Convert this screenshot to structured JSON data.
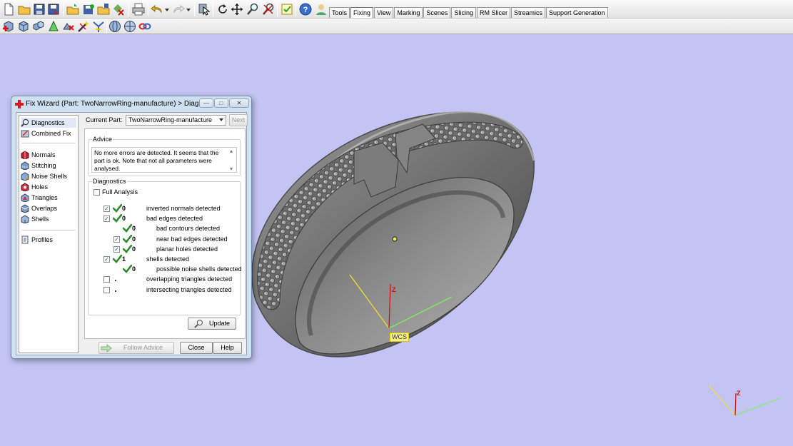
{
  "tabs": [
    {
      "label": "Tools",
      "active": false
    },
    {
      "label": "Fixing",
      "active": true
    },
    {
      "label": "View",
      "active": false
    },
    {
      "label": "Marking",
      "active": false
    },
    {
      "label": "Scenes",
      "active": false
    },
    {
      "label": "Slicing",
      "active": false
    },
    {
      "label": "RM Slicer",
      "active": false
    },
    {
      "label": "Streamics",
      "active": false
    },
    {
      "label": "Support Generation",
      "active": false
    }
  ],
  "toolbar_icons": [
    "new-file-icon",
    "open-folder-icon",
    "save-icon",
    "save-as-icon",
    "import-icon",
    "save-project-icon",
    "load-icon",
    "export-icon",
    "print-icon",
    "undo-icon",
    "redo-icon",
    "select-part-icon",
    "rotate-icon",
    "pan-icon",
    "zoom-icon",
    "zoom-fit-icon",
    "checklist-icon",
    "help-icon",
    "about-icon"
  ],
  "fix_toolbar_icons": [
    "add-part-icon",
    "box-icon",
    "cubes-icon",
    "triangle-icon",
    "delete-triangles-icon",
    "wand-icon",
    "sew-icon",
    "sphere-icon",
    "sphere-grid-icon",
    "link-icon"
  ],
  "wizard": {
    "title": "Fix Wizard (Part: TwoNarrowRing-manufacture) > Diagnostics",
    "nav": [
      {
        "label": "Diagnostics",
        "icon": "magnifier-icon",
        "selected": true
      },
      {
        "label": "Combined Fix",
        "icon": "combined-fix-icon",
        "selected": false
      },
      {
        "label": "Normals",
        "icon": "normals-icon",
        "selected": false
      },
      {
        "label": "Stitching",
        "icon": "stitching-icon",
        "selected": false
      },
      {
        "label": "Noise Shells",
        "icon": "noise-shells-icon",
        "selected": false
      },
      {
        "label": "Holes",
        "icon": "holes-icon",
        "selected": false
      },
      {
        "label": "Triangles",
        "icon": "triangles-icon",
        "selected": false
      },
      {
        "label": "Overlaps",
        "icon": "overlaps-icon",
        "selected": false
      },
      {
        "label": "Shells",
        "icon": "shells-icon",
        "selected": false
      },
      {
        "label": "Profiles",
        "icon": "profiles-icon",
        "selected": false
      }
    ],
    "current_part_label": "Current Part:",
    "current_part_value": "TwoNarrowRing-manufacture",
    "next_label": "Next",
    "advice_title": "Advice",
    "advice_text": "No more errors are detected. It seems that the part is ok. Note that not all parameters were analysed.",
    "diagnostics_title": "Diagnostics",
    "full_analysis_label": "Full Analysis",
    "full_analysis_checked": false,
    "rows": [
      {
        "checked": true,
        "status": "ok",
        "count": "0",
        "label": "inverted normals detected",
        "indent": 0
      },
      {
        "checked": true,
        "status": "ok",
        "count": "0",
        "label": "bad edges detected",
        "indent": 0
      },
      {
        "checked": null,
        "status": "ok",
        "count": "0",
        "label": "bad contours detected",
        "indent": 1
      },
      {
        "checked": true,
        "status": "ok",
        "count": "0",
        "label": "near bad edges detected",
        "indent": 1
      },
      {
        "checked": true,
        "status": "ok",
        "count": "0",
        "label": "planar holes detected",
        "indent": 1
      },
      {
        "checked": true,
        "status": "ok",
        "count": "1",
        "label": "shells detected",
        "indent": 0
      },
      {
        "checked": null,
        "status": "ok",
        "count": "0",
        "label": "possible noise shells detected",
        "indent": 1
      },
      {
        "checked": false,
        "status": "none",
        "count": "",
        "label": "overlapping triangles detected",
        "indent": 0
      },
      {
        "checked": false,
        "status": "none",
        "count": "",
        "label": "intersecting triangles detected",
        "indent": 0
      }
    ],
    "update_label": "Update",
    "follow_advice_label": "Follow Advice",
    "close_label": "Close",
    "help_label": "Help"
  },
  "viewport": {
    "wcs_label": "WCS",
    "axis_z_label": "Z",
    "corner_axis_z_label": "Z"
  },
  "colors": {
    "viewport_bg": "#c4c4f4",
    "check_green": "#2e8b2e",
    "axis_x": "#7cf05c",
    "axis_y": "#f0e030",
    "axis_z": "#d01010"
  }
}
